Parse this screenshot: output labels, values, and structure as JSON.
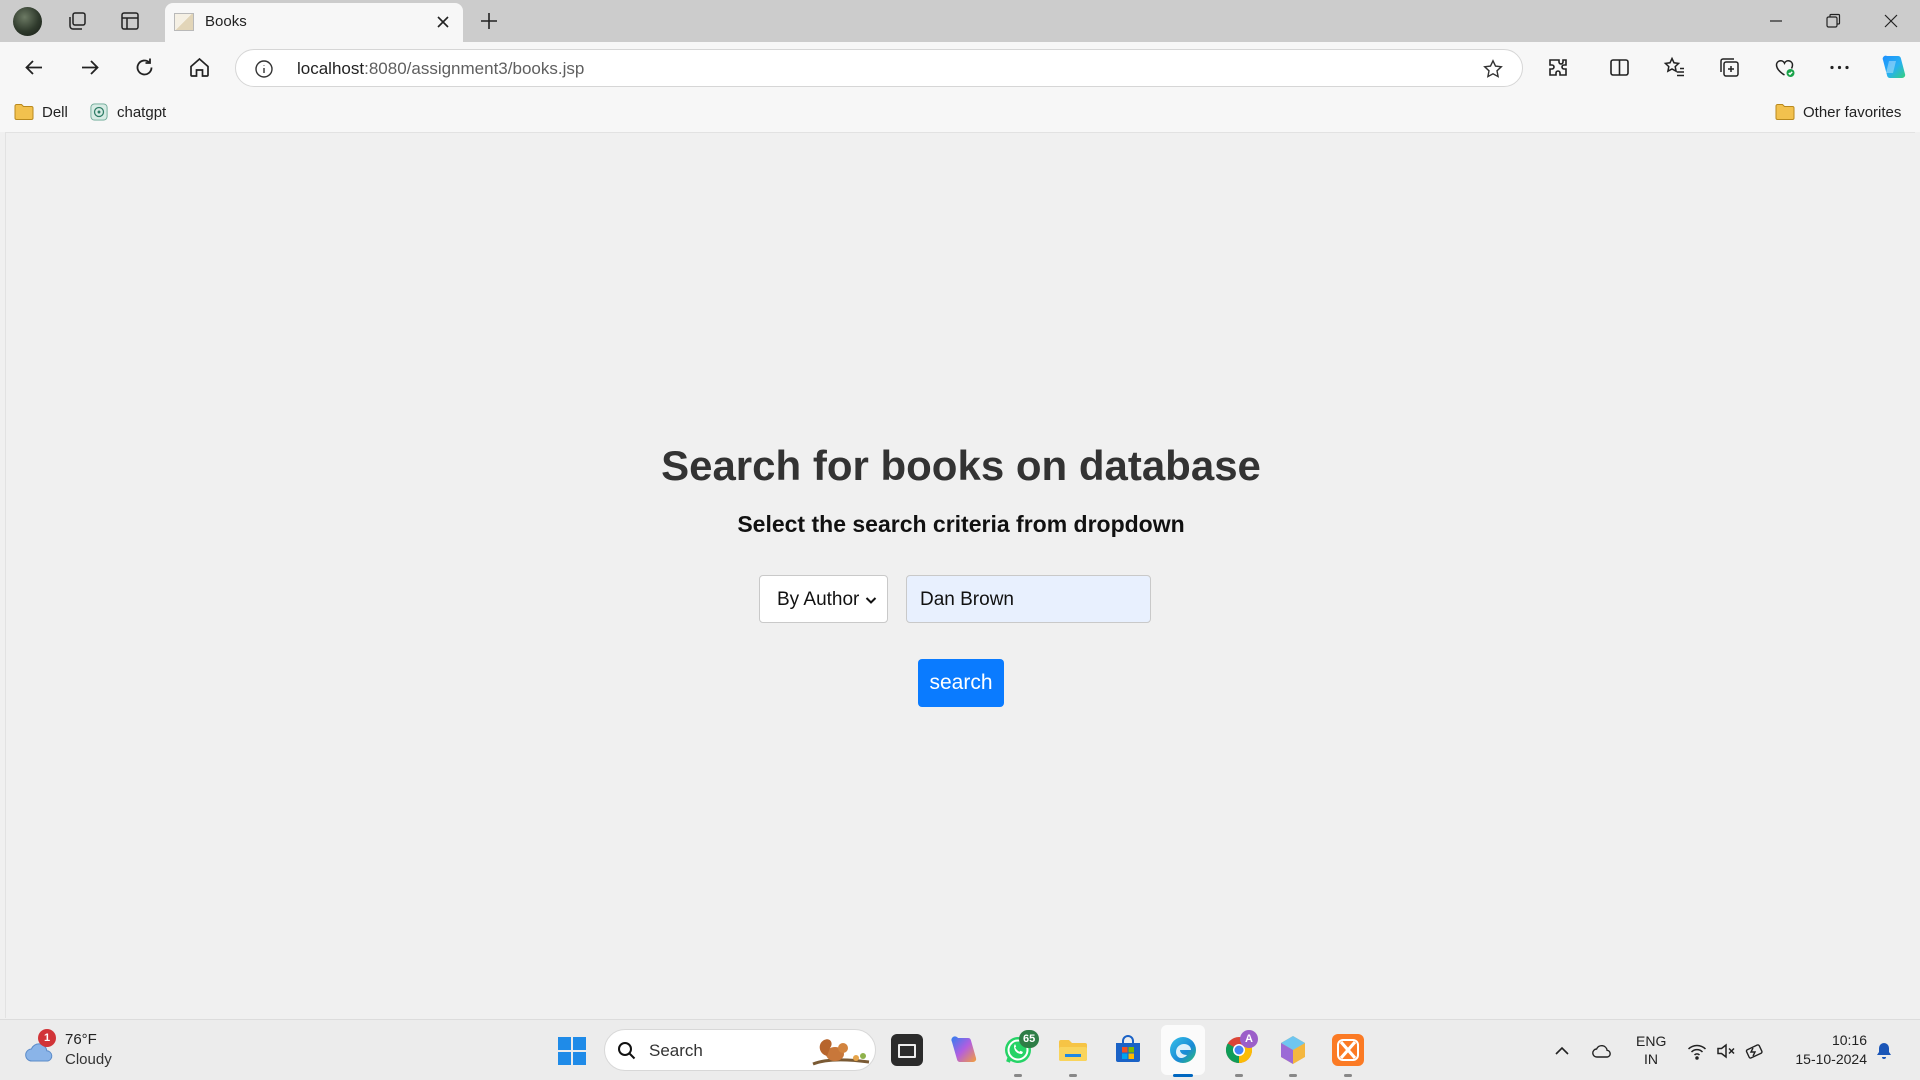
{
  "browser": {
    "tab": {
      "title": "Books"
    },
    "address": {
      "host": "localhost",
      "path": ":8080/assignment3/books.jsp"
    },
    "favorites": [
      {
        "label": "Dell",
        "icon": "folder-icon"
      },
      {
        "label": "chatgpt",
        "icon": "chatgpt-icon"
      }
    ],
    "other_favorites": "Other favorites"
  },
  "page": {
    "title": "Search for books on database",
    "subtitle": "Select the search criteria from dropdown",
    "criteria_select": {
      "selected": "By Author"
    },
    "query_input": {
      "value": "Dan Brown"
    },
    "search_button": "search"
  },
  "taskbar": {
    "weather": {
      "temp": "76°F",
      "condition": "Cloudy",
      "badge": "1"
    },
    "search_placeholder": "Search",
    "whatsapp_badge": "65",
    "chrome_badge": "A",
    "language": {
      "line1": "ENG",
      "line2": "IN"
    },
    "clock": {
      "time": "10:16",
      "date": "15-10-2024"
    }
  },
  "colors": {
    "accent": "#0a7bff",
    "input_autofill": "#e8f0fe",
    "page_background": "#f0f0f0"
  }
}
